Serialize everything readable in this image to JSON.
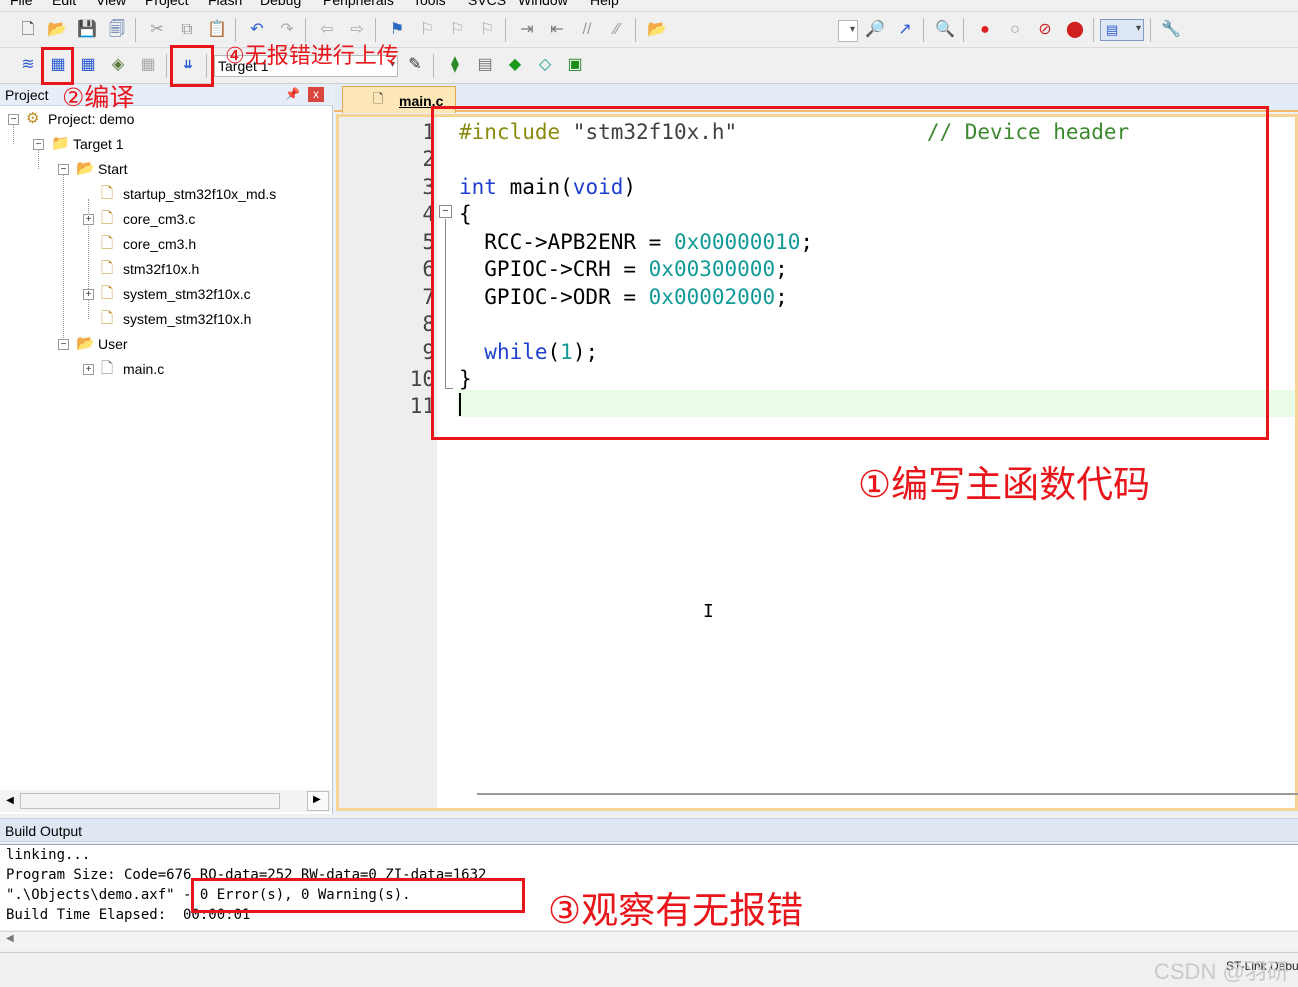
{
  "menu": [
    "File",
    "Edit",
    "View",
    "Project",
    "Flash",
    "Debug",
    "Peripherals",
    "Tools",
    "SVCS",
    "Window",
    "Help"
  ],
  "toolbar": {
    "target_label": "Target 1"
  },
  "project_panel": {
    "title": "Project",
    "pin": "ᵖ",
    "close": "x",
    "tree": {
      "project": "Project: demo",
      "target": "Target 1",
      "groups": [
        {
          "name": "Start",
          "files": [
            "startup_stm32f10x_md.s",
            "core_cm3.c",
            "core_cm3.h",
            "stm32f10x.h",
            "system_stm32f10x.c",
            "system_stm32f10x.h"
          ]
        },
        {
          "name": "User",
          "files": [
            "main.c"
          ]
        }
      ]
    }
  },
  "editor": {
    "tab": "main.c",
    "line_numbers": [
      "1",
      "2",
      "3",
      "4",
      "5",
      "6",
      "7",
      "8",
      "9",
      "10",
      "11"
    ]
  },
  "build_output": {
    "title": "Build Output",
    "lines": [
      "linking...",
      "Program Size: Code=676 RO-data=252 RW-data=0 ZI-data=1632",
      "\".\\Objects\\demo.axf\" - 0 Error(s), 0 Warning(s).",
      "Build Time Elapsed:  00:00:01"
    ]
  },
  "status": {
    "debugger": "ST-Link Debugger"
  },
  "annotations": {
    "write_code": "①编写主函数代码",
    "compile": "②编译",
    "check_errors": "③观察有无报错",
    "upload": "④无报错进行上传"
  },
  "watermark": "CSDN @羽研"
}
